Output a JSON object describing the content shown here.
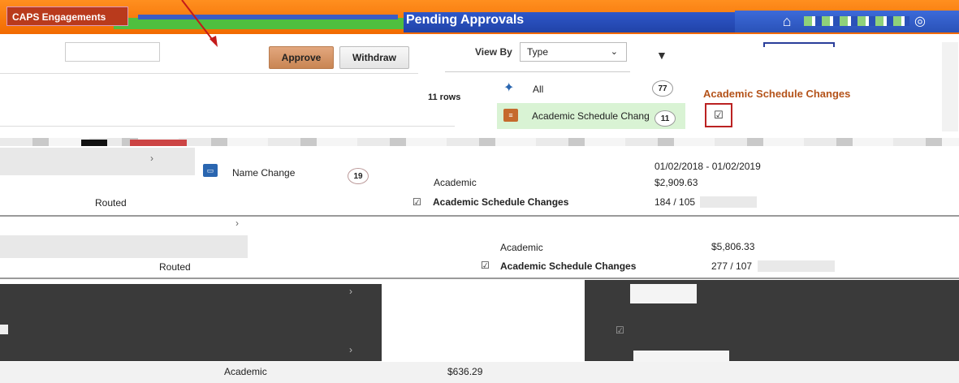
{
  "header": {
    "tab_label": "CAPS Engagements",
    "page_title": "Pending Approvals",
    "home_icon": "home-icon",
    "nav_icons": "nav-strip-icons",
    "globe_icon": "globe-icon"
  },
  "actions": {
    "approve_label": "Approve",
    "withdraw_label": "Withdraw"
  },
  "view_by": {
    "label": "View By",
    "selected": "Type"
  },
  "list": {
    "row_count": "11 rows"
  },
  "filter_panel": {
    "items": [
      {
        "label": "All",
        "count": "77"
      },
      {
        "label": "Academic Schedule Chang",
        "count": "11"
      },
      {
        "label": "Name Change",
        "count": "19"
      }
    ]
  },
  "right_panel": {
    "title": "Academic Schedule Changes"
  },
  "records": [
    {
      "date_range": "01/02/2018 - 01/02/2019",
      "category": "Academic",
      "amount": "$2,909.63",
      "type": "Academic Schedule Changes",
      "code": "184 / 105",
      "status": "Routed"
    },
    {
      "category": "Academic",
      "amount": "$5,806.33",
      "type": "Academic Schedule Changes",
      "code": "277 / 107",
      "status": "Routed"
    },
    {
      "category": "Academic",
      "amount": "$636.29"
    }
  ],
  "colors": {
    "header_orange": "#f26a00",
    "title_blue": "#2143a8",
    "approve_brown": "#c98553",
    "accent_orange_text": "#b4531a",
    "selected_green": "#d9f3d4",
    "highlight_red": "#b22222"
  }
}
